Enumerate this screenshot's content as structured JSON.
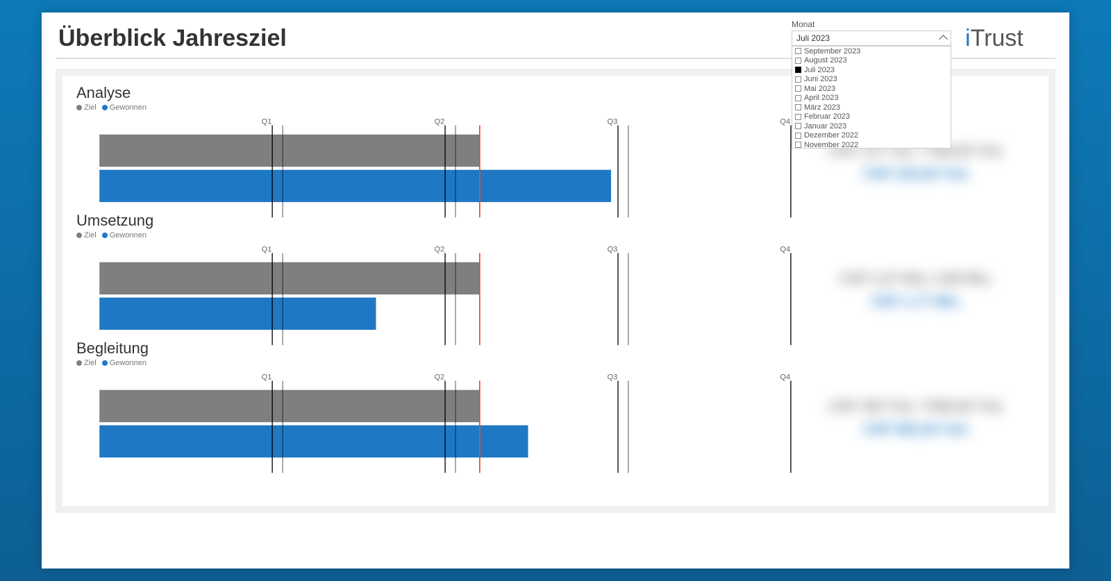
{
  "header": {
    "title": "Überblick Jahresziel",
    "brand_i": "i",
    "brand_rest": "Trust"
  },
  "filter": {
    "label": "Monat",
    "selected": "Juli 2023",
    "options": [
      "September 2023",
      "August 2023",
      "Juli 2023",
      "Juni 2023",
      "Mai 2023",
      "April 2023",
      "März 2023",
      "Februar 2023",
      "Januar 2023",
      "Dezember 2022",
      "November 2022"
    ]
  },
  "legend": {
    "ziel": "Ziel",
    "gewonnen": "Gewonnen"
  },
  "chart_data": [
    {
      "type": "bar",
      "title": "Analyse",
      "x_markers": [
        "Q1",
        "Q2",
        "Q3",
        "Q4"
      ],
      "reference_pct": 55,
      "series": [
        {
          "name": "Ziel",
          "value_pct": 55
        },
        {
          "name": "Gewonnen",
          "value_pct": 74
        }
      ],
      "values_blurred": {
        "line1": "CHF 137 Tsd.   7'390,00 Tsd.",
        "line2": "CHF 232,00 Tsd."
      }
    },
    {
      "type": "bar",
      "title": "Umsetzung",
      "x_markers": [
        "Q1",
        "Q2",
        "Q3",
        "Q4"
      ],
      "reference_pct": 55,
      "series": [
        {
          "name": "Ziel",
          "value_pct": 55
        },
        {
          "name": "Gewonnen",
          "value_pct": 40
        }
      ],
      "values_blurred": {
        "line1": "CHF 2,37 Mio.   0,88 Mio.",
        "line2": "CHF 1,77 Mio."
      }
    },
    {
      "type": "bar",
      "title": "Begleitung",
      "x_markers": [
        "Q1",
        "Q2",
        "Q3",
        "Q4"
      ],
      "reference_pct": 55,
      "series": [
        {
          "name": "Ziel",
          "value_pct": 55
        },
        {
          "name": "Gewonnen",
          "value_pct": 62
        }
      ],
      "values_blurred": {
        "line1": "CHF 350 Tsd.   7'690,00 Tsd.",
        "line2": "CHF 883,45 Tsd."
      }
    }
  ]
}
